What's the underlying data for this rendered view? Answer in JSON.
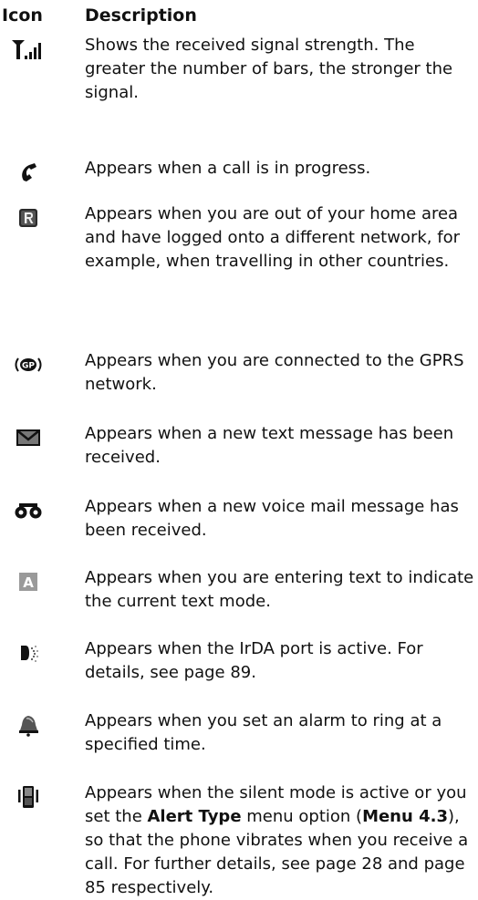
{
  "header": {
    "icon": "Icon",
    "description": "Description"
  },
  "rows": [
    {
      "icon": "signal-strength-icon",
      "text": "Shows the received signal strength. The greater the number of bars, the stronger the signal."
    },
    {
      "icon": "call-in-progress-icon",
      "text": "Appears when a call is in progress."
    },
    {
      "icon": "roaming-icon",
      "text": "Appears when you are out of your home area and have logged onto a different network, for example, when travelling in other countries."
    },
    {
      "icon": "gprs-icon",
      "text": "Appears when you are connected to the GPRS network."
    },
    {
      "icon": "text-message-icon",
      "text": "Appears when a new text message has been received."
    },
    {
      "icon": "voice-mail-icon",
      "text": "Appears when a new voice mail message has been received."
    },
    {
      "icon": "text-mode-icon",
      "text": "Appears when you are entering text to indicate the current text mode."
    },
    {
      "icon": "irda-port-icon",
      "text": "Appears when the IrDA port is active. For details, see page 89."
    },
    {
      "icon": "alarm-icon",
      "text": "Appears when you set an alarm to ring at a specified time."
    },
    {
      "icon": "silent-mode-icon",
      "text_a": "Appears when the silent mode is active or you set the ",
      "bold_a": "Alert Type",
      "text_b": " menu option (",
      "bold_b": "Menu 4.3",
      "text_c": "), so that the phone vibrates when you receive a call. For further details, see page 28 and page 85 respectively."
    }
  ]
}
